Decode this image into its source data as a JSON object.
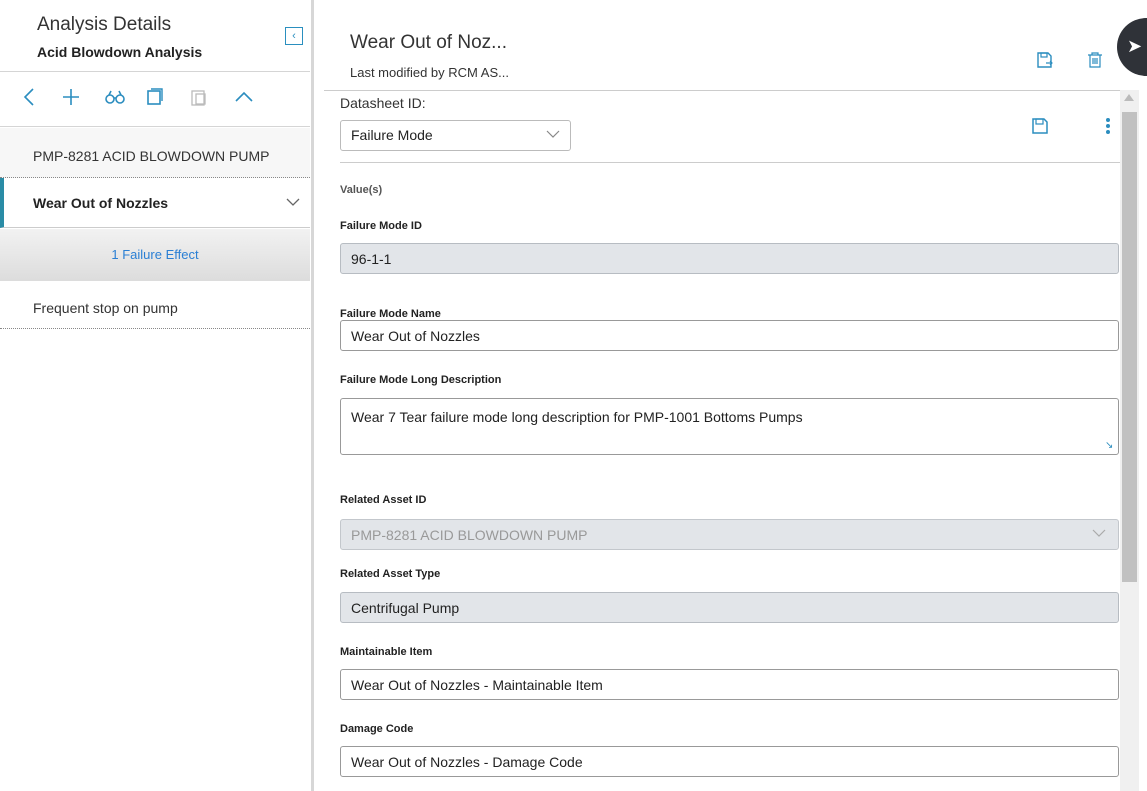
{
  "left": {
    "title": "Analysis Details",
    "subtitle": "Acid Blowdown Analysis",
    "collapse_icon": "chevron-left-icon",
    "toolbar_icons": [
      "back-icon",
      "add-icon",
      "binoculars-icon",
      "copy-icon",
      "paste-icon",
      "chevron-up-icon"
    ],
    "items": [
      {
        "label": "PMP-8281 ACID BLOWDOWN PUMP"
      },
      {
        "label": "Wear Out of Nozzles"
      },
      {
        "label": "1 Failure Effect"
      },
      {
        "label": "Frequent stop on pump"
      }
    ]
  },
  "header": {
    "title": "Wear Out of Noz...",
    "subtitle": "Last modified by RCM AS..."
  },
  "form": {
    "datasheet_label": "Datasheet ID:",
    "datasheet_value": "Failure Mode",
    "values_label": "Value(s)",
    "fields": [
      {
        "label": "Failure Mode ID",
        "value": "96-1-1"
      },
      {
        "label": "Failure Mode Name",
        "value": "Wear Out of Nozzles"
      },
      {
        "label": "Failure Mode Long Description",
        "value": "Wear 7 Tear failure mode long description for PMP-1001 Bottoms Pumps"
      },
      {
        "label": "Related Asset ID",
        "value": "PMP-8281 ACID BLOWDOWN PUMP"
      },
      {
        "label": "Related Asset Type",
        "value": "Centrifugal Pump"
      },
      {
        "label": "Maintainable Item",
        "value": "Wear Out of Nozzles - Maintainable Item"
      },
      {
        "label": "Damage Code",
        "value": "Wear Out of Nozzles - Damage Code"
      }
    ]
  },
  "colors": {
    "accent": "#2b8dbf",
    "selected_bar": "#2a8ca6",
    "link": "#2a7fd4"
  }
}
